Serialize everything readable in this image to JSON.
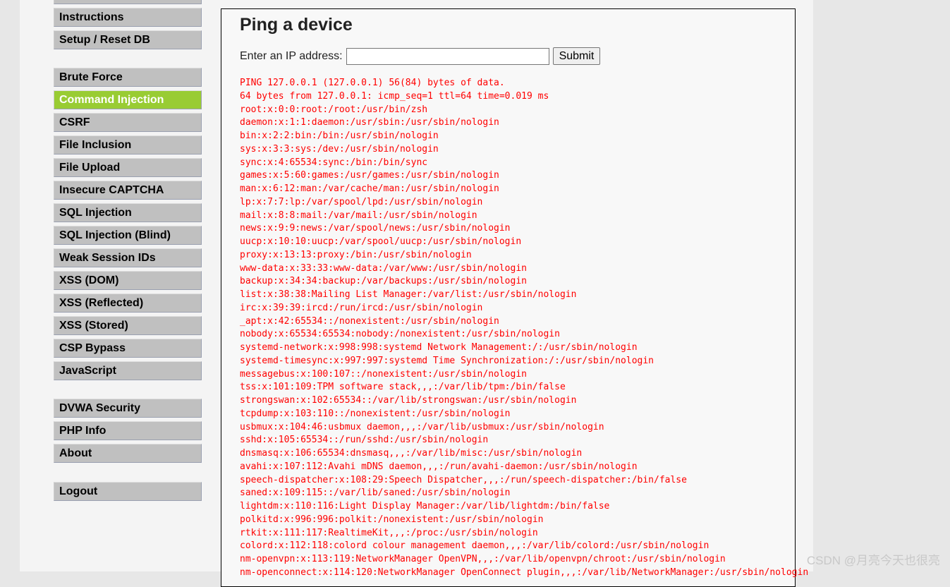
{
  "menu": {
    "items": [
      {
        "label": ""
      },
      {
        "label": "Instructions"
      },
      {
        "label": "Setup / Reset DB"
      },
      {
        "label": "Brute Force"
      },
      {
        "label": "Command Injection",
        "selected": true
      },
      {
        "label": "CSRF"
      },
      {
        "label": "File Inclusion"
      },
      {
        "label": "File Upload"
      },
      {
        "label": "Insecure CAPTCHA"
      },
      {
        "label": "SQL Injection"
      },
      {
        "label": "SQL Injection (Blind)"
      },
      {
        "label": "Weak Session IDs"
      },
      {
        "label": "XSS (DOM)"
      },
      {
        "label": "XSS (Reflected)"
      },
      {
        "label": "XSS (Stored)"
      },
      {
        "label": "CSP Bypass"
      },
      {
        "label": "JavaScript"
      },
      {
        "label": "DVWA Security"
      },
      {
        "label": "PHP Info"
      },
      {
        "label": "About"
      },
      {
        "label": "Logout"
      }
    ]
  },
  "main": {
    "title": "Ping a device",
    "ip_label": "Enter an IP address:",
    "ip_value": "",
    "submit_label": "Submit",
    "output": "PING 127.0.0.1 (127.0.0.1) 56(84) bytes of data.\n64 bytes from 127.0.0.1: icmp_seq=1 ttl=64 time=0.019 ms\nroot:x:0:0:root:/root:/usr/bin/zsh\ndaemon:x:1:1:daemon:/usr/sbin:/usr/sbin/nologin\nbin:x:2:2:bin:/bin:/usr/sbin/nologin\nsys:x:3:3:sys:/dev:/usr/sbin/nologin\nsync:x:4:65534:sync:/bin:/bin/sync\ngames:x:5:60:games:/usr/games:/usr/sbin/nologin\nman:x:6:12:man:/var/cache/man:/usr/sbin/nologin\nlp:x:7:7:lp:/var/spool/lpd:/usr/sbin/nologin\nmail:x:8:8:mail:/var/mail:/usr/sbin/nologin\nnews:x:9:9:news:/var/spool/news:/usr/sbin/nologin\nuucp:x:10:10:uucp:/var/spool/uucp:/usr/sbin/nologin\nproxy:x:13:13:proxy:/bin:/usr/sbin/nologin\nwww-data:x:33:33:www-data:/var/www:/usr/sbin/nologin\nbackup:x:34:34:backup:/var/backups:/usr/sbin/nologin\nlist:x:38:38:Mailing List Manager:/var/list:/usr/sbin/nologin\nirc:x:39:39:ircd:/run/ircd:/usr/sbin/nologin\n_apt:x:42:65534::/nonexistent:/usr/sbin/nologin\nnobody:x:65534:65534:nobody:/nonexistent:/usr/sbin/nologin\nsystemd-network:x:998:998:systemd Network Management:/:/usr/sbin/nologin\nsystemd-timesync:x:997:997:systemd Time Synchronization:/:/usr/sbin/nologin\nmessagebus:x:100:107::/nonexistent:/usr/sbin/nologin\ntss:x:101:109:TPM software stack,,,:/var/lib/tpm:/bin/false\nstrongswan:x:102:65534::/var/lib/strongswan:/usr/sbin/nologin\ntcpdump:x:103:110::/nonexistent:/usr/sbin/nologin\nusbmux:x:104:46:usbmux daemon,,,:/var/lib/usbmux:/usr/sbin/nologin\nsshd:x:105:65534::/run/sshd:/usr/sbin/nologin\ndnsmasq:x:106:65534:dnsmasq,,,:/var/lib/misc:/usr/sbin/nologin\navahi:x:107:112:Avahi mDNS daemon,,,:/run/avahi-daemon:/usr/sbin/nologin\nspeech-dispatcher:x:108:29:Speech Dispatcher,,,:/run/speech-dispatcher:/bin/false\nsaned:x:109:115::/var/lib/saned:/usr/sbin/nologin\nlightdm:x:110:116:Light Display Manager:/var/lib/lightdm:/bin/false\npolkitd:x:996:996:polkit:/nonexistent:/usr/sbin/nologin\nrtkit:x:111:117:RealtimeKit,,,:/proc:/usr/sbin/nologin\ncolord:x:112:118:colord colour management daemon,,,:/var/lib/colord:/usr/sbin/nologin\nnm-openvpn:x:113:119:NetworkManager OpenVPN,,,:/var/lib/openvpn/chroot:/usr/sbin/nologin\nnm-openconnect:x:114:120:NetworkManager OpenConnect plugin,,,:/var/lib/NetworkManager:/usr/sbin/nologin"
  },
  "watermark": "CSDN @月亮今天也很亮",
  "colors": {
    "selected": "#99cc33",
    "output": "#ff0000"
  }
}
